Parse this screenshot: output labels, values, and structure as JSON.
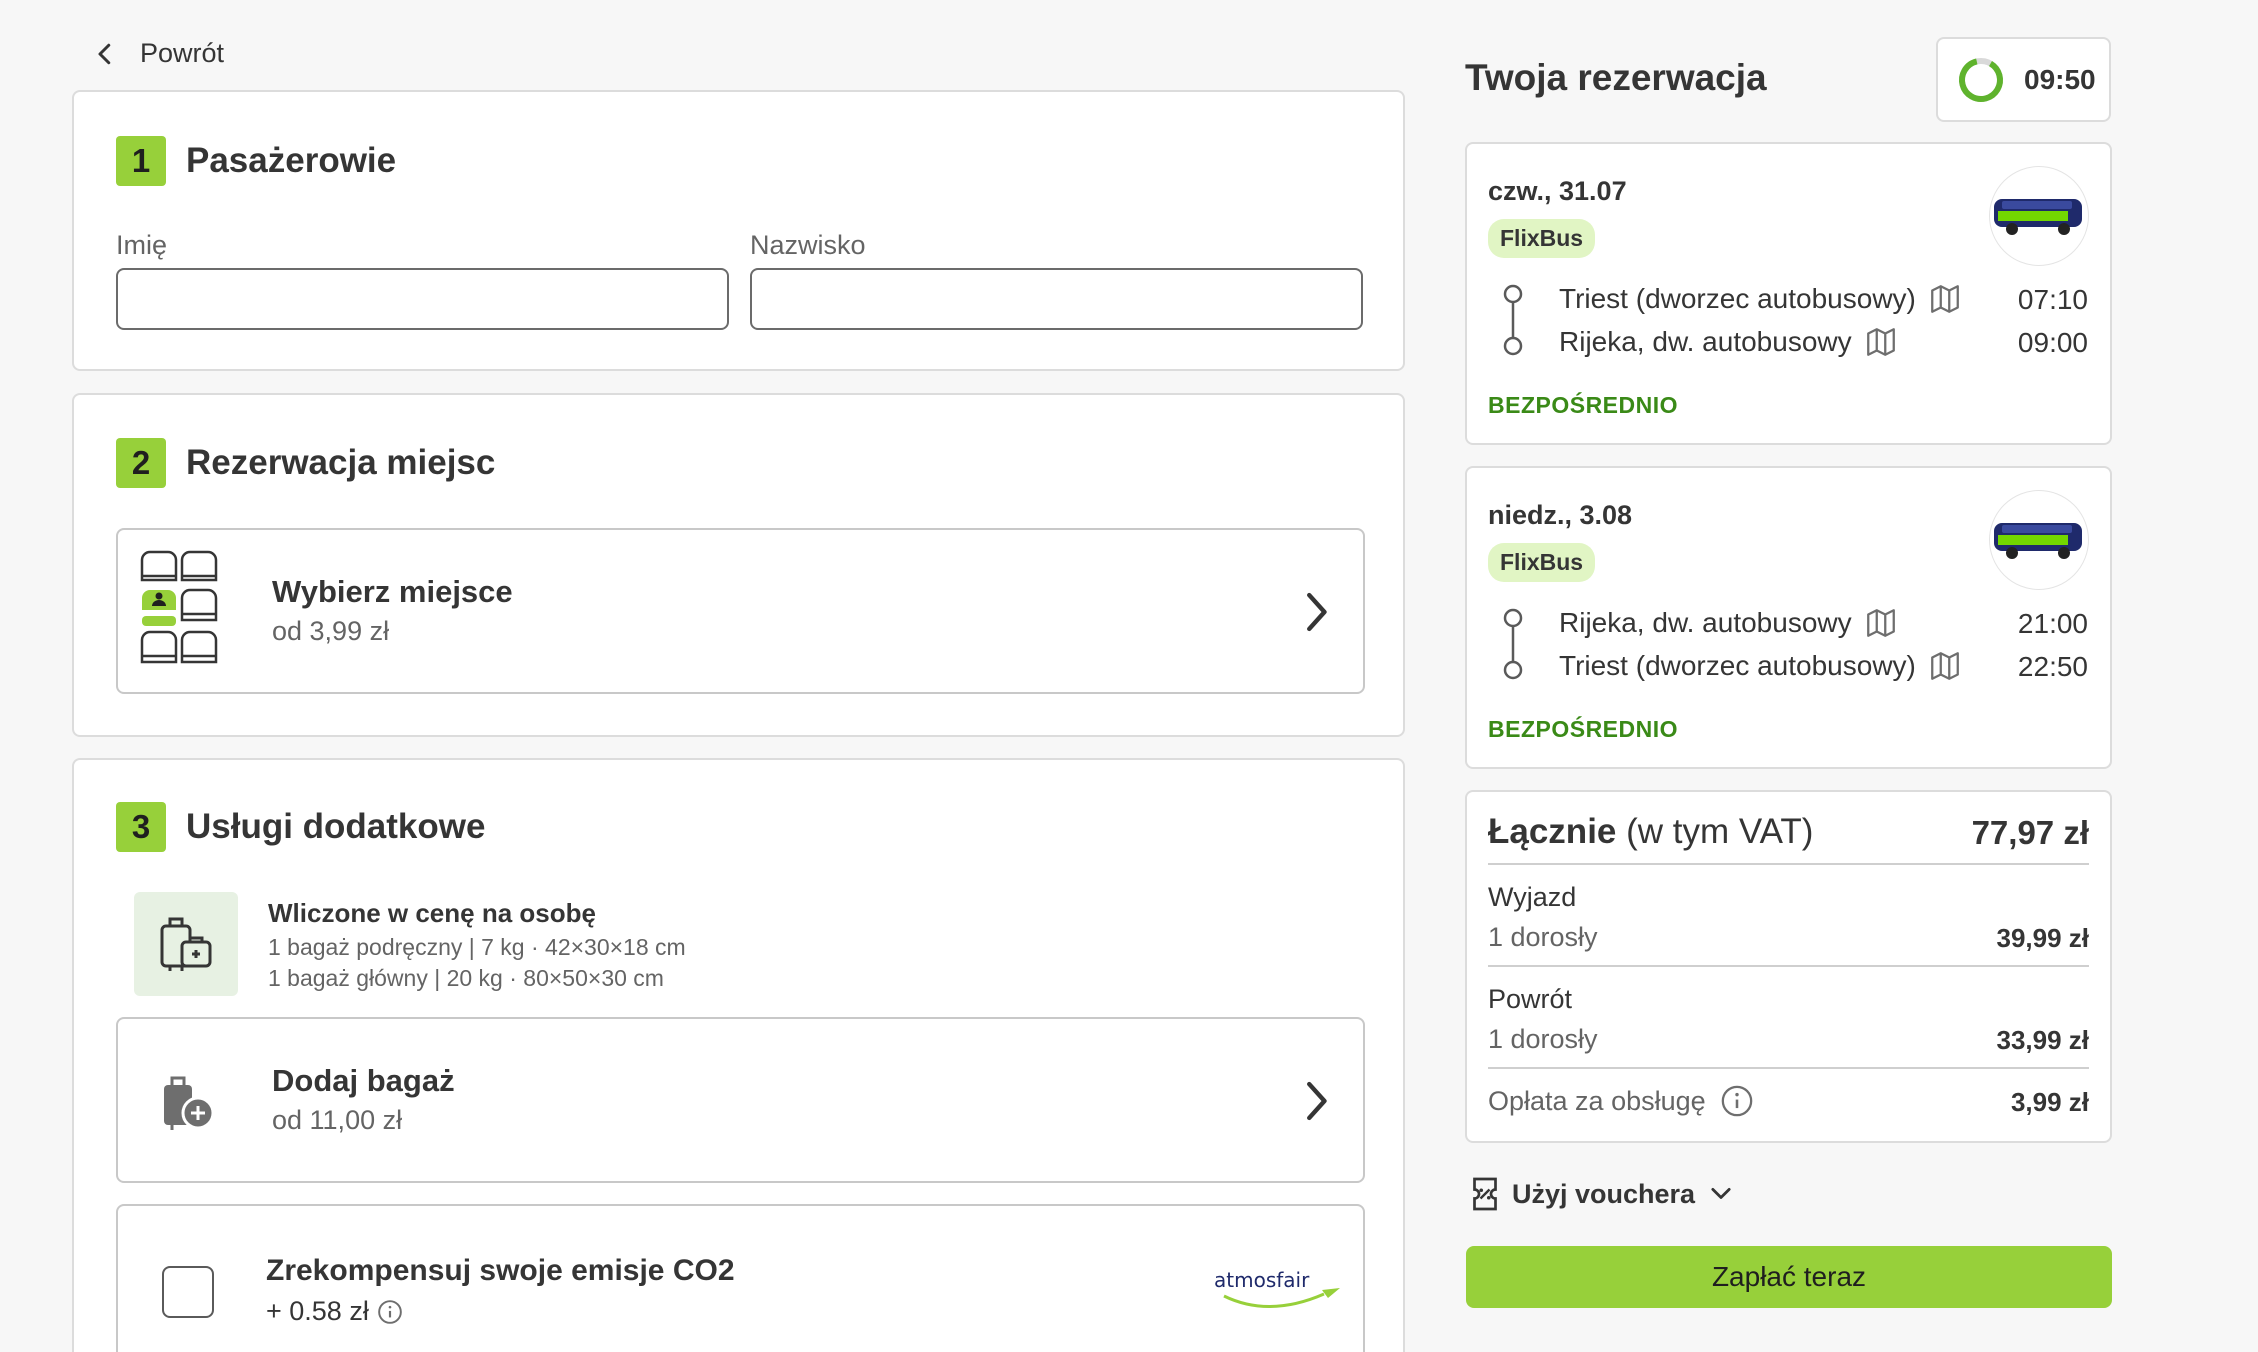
{
  "back_label": "Powrót",
  "sections": {
    "passengers": {
      "number": "1",
      "title": "Pasażerowie",
      "first_name_label": "Imię",
      "last_name_label": "Nazwisko",
      "first_name_value": "",
      "last_name_value": ""
    },
    "seats": {
      "number": "2",
      "title": "Rezerwacja miejsc",
      "option_title": "Wybierz miejsce",
      "option_sub": "od 3,99 zł"
    },
    "extras": {
      "number": "3",
      "title": "Usługi dodatkowe",
      "included_title": "Wliczone w cenę na osobę",
      "included_line1": "1 bagaż podręczny | 7 kg · 42×30×18 cm",
      "included_line2": "1 bagaż główny | 20 kg · 80×50×30 cm",
      "add_bag_title": "Dodaj bagaż",
      "add_bag_sub": "od 11,00 zł",
      "co2_title": "Zrekompensuj swoje emisje CO2",
      "co2_price": "+ 0.58 zł",
      "co2_partner": "atmosfair",
      "co2_checked": false
    }
  },
  "reservation": {
    "title": "Twoja rezerwacja",
    "timer": "09:50",
    "trips": [
      {
        "date": "czw., 31.07",
        "operator": "FlixBus",
        "from": "Triest (dworzec autobusowy)",
        "to": "Rijeka, dw. autobusowy",
        "dep": "07:10",
        "arr": "09:00",
        "type": "BEZPOŚREDNIO"
      },
      {
        "date": "niedz., 3.08",
        "operator": "FlixBus",
        "from": "Rijeka, dw. autobusowy",
        "to": "Triest (dworzec autobusowy)",
        "dep": "21:00",
        "arr": "22:50",
        "type": "BEZPOŚREDNIO"
      }
    ],
    "summary": {
      "total_label": "Łącznie",
      "total_vat": "(w tym VAT)",
      "total_value": "77,97 zł",
      "outbound_label": "Wyjazd",
      "outbound_pax": "1 dorosły",
      "outbound_value": "39,99 zł",
      "return_label": "Powrót",
      "return_pax": "1 dorosły",
      "return_value": "33,99 zł",
      "fee_label": "Opłata za obsługę",
      "fee_value": "3,99 zł"
    },
    "voucher_label": "Użyj vouchera",
    "pay_label": "Zapłać teraz"
  },
  "colors": {
    "accent": "#97d03a",
    "direct": "#3a8a17",
    "badge_bg": "#e1f5c4",
    "bus_blue": "#1f2a6b"
  }
}
